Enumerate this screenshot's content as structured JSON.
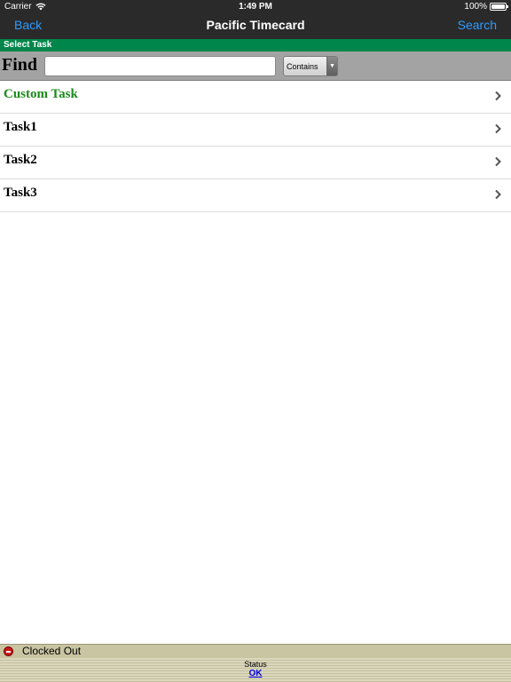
{
  "status_bar": {
    "carrier": "Carrier",
    "time": "1:49 PM",
    "battery": "100%",
    "battery_level": 1.0,
    "wifi_icon": "wifi-icon",
    "battery_icon": "battery-icon"
  },
  "nav": {
    "back_label": "Back",
    "title": "Pacific Timecard",
    "search_label": "Search"
  },
  "section": {
    "title": "Select Task"
  },
  "find": {
    "label": "Find",
    "input_value": "",
    "select_value": "Contains",
    "select_arrow_icon": "triangle-down-icon"
  },
  "tasks": [
    {
      "label": "Custom Task",
      "highlight": true
    },
    {
      "label": "Task1",
      "highlight": false
    },
    {
      "label": "Task2",
      "highlight": false
    },
    {
      "label": "Task3",
      "highlight": false
    }
  ],
  "footer": {
    "status_text": "Clocked Out",
    "status_icon": "no-entry-icon",
    "panel_label": "Status",
    "panel_value": "OK"
  },
  "colors": {
    "nav_background": "#2a2a2a",
    "link_blue": "#2d9bff",
    "section_green": "#00864a",
    "custom_task_green": "#1a8a1a",
    "footer_tan": "#c9c4a2"
  }
}
